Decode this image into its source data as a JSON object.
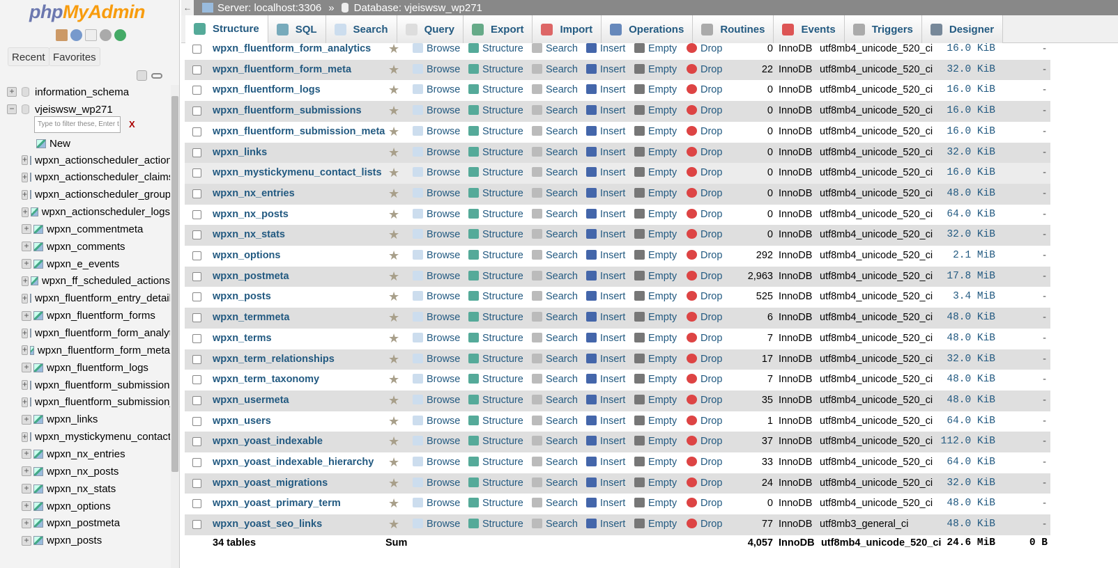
{
  "sidebar": {
    "logo_php": "php",
    "logo_myadmin": "MyAdmin",
    "recent": "Recent",
    "favorites": "Favorites",
    "filter_placeholder": "Type to filter these, Enter t",
    "filter_clear": "X",
    "databases": [
      "information_schema",
      "vjeiswsw_wp271"
    ],
    "new_label": "New",
    "tables": [
      "wpxn_actionscheduler_actions",
      "wpxn_actionscheduler_claims",
      "wpxn_actionscheduler_groups",
      "wpxn_actionscheduler_logs",
      "wpxn_commentmeta",
      "wpxn_comments",
      "wpxn_e_events",
      "wpxn_ff_scheduled_actions",
      "wpxn_fluentform_entry_details",
      "wpxn_fluentform_forms",
      "wpxn_fluentform_form_analytics",
      "wpxn_fluentform_form_meta",
      "wpxn_fluentform_logs",
      "wpxn_fluentform_submissions",
      "wpxn_fluentform_submission_meta",
      "wpxn_links",
      "wpxn_mystickymenu_contact_lists",
      "wpxn_nx_entries",
      "wpxn_nx_posts",
      "wpxn_nx_stats",
      "wpxn_options",
      "wpxn_postmeta",
      "wpxn_posts"
    ]
  },
  "breadcrumb": {
    "server": "Server: localhost:3306",
    "sep": "»",
    "database": "Database: vjeiswsw_wp271"
  },
  "tabs": [
    {
      "label": "Structure",
      "color": "#5a9"
    },
    {
      "label": "SQL",
      "color": "#7ab"
    },
    {
      "label": "Search",
      "color": "#cde"
    },
    {
      "label": "Query",
      "color": "#ddd"
    },
    {
      "label": "Export",
      "color": "#6a8"
    },
    {
      "label": "Import",
      "color": "#d66"
    },
    {
      "label": "Operations",
      "color": "#68b"
    },
    {
      "label": "Routines",
      "color": "#aaa"
    },
    {
      "label": "Events",
      "color": "#d55"
    },
    {
      "label": "Triggers",
      "color": "#aaa"
    },
    {
      "label": "Designer",
      "color": "#789"
    }
  ],
  "actions": {
    "browse": "Browse",
    "structure": "Structure",
    "search": "Search",
    "insert": "Insert",
    "empty": "Empty",
    "drop": "Drop"
  },
  "rows": [
    [
      "wpxn_fluentform_form_analytics",
      "0",
      "InnoDB",
      "utf8mb4_unicode_520_ci",
      "16.0 KiB",
      "-"
    ],
    [
      "wpxn_fluentform_form_meta",
      "22",
      "InnoDB",
      "utf8mb4_unicode_520_ci",
      "32.0 KiB",
      "-"
    ],
    [
      "wpxn_fluentform_logs",
      "0",
      "InnoDB",
      "utf8mb4_unicode_520_ci",
      "16.0 KiB",
      "-"
    ],
    [
      "wpxn_fluentform_submissions",
      "0",
      "InnoDB",
      "utf8mb4_unicode_520_ci",
      "16.0 KiB",
      "-"
    ],
    [
      "wpxn_fluentform_submission_meta",
      "0",
      "InnoDB",
      "utf8mb4_unicode_520_ci",
      "16.0 KiB",
      "-"
    ],
    [
      "wpxn_links",
      "0",
      "InnoDB",
      "utf8mb4_unicode_520_ci",
      "32.0 KiB",
      "-"
    ],
    [
      "wpxn_mystickymenu_contact_lists",
      "0",
      "InnoDB",
      "utf8mb4_unicode_520_ci",
      "16.0 KiB",
      "-"
    ],
    [
      "wpxn_nx_entries",
      "0",
      "InnoDB",
      "utf8mb4_unicode_520_ci",
      "48.0 KiB",
      "-"
    ],
    [
      "wpxn_nx_posts",
      "0",
      "InnoDB",
      "utf8mb4_unicode_520_ci",
      "64.0 KiB",
      "-"
    ],
    [
      "wpxn_nx_stats",
      "0",
      "InnoDB",
      "utf8mb4_unicode_520_ci",
      "32.0 KiB",
      "-"
    ],
    [
      "wpxn_options",
      "292",
      "InnoDB",
      "utf8mb4_unicode_520_ci",
      "2.1 MiB",
      "-"
    ],
    [
      "wpxn_postmeta",
      "2,963",
      "InnoDB",
      "utf8mb4_unicode_520_ci",
      "17.8 MiB",
      "-"
    ],
    [
      "wpxn_posts",
      "525",
      "InnoDB",
      "utf8mb4_unicode_520_ci",
      "3.4 MiB",
      "-"
    ],
    [
      "wpxn_termmeta",
      "6",
      "InnoDB",
      "utf8mb4_unicode_520_ci",
      "48.0 KiB",
      "-"
    ],
    [
      "wpxn_terms",
      "7",
      "InnoDB",
      "utf8mb4_unicode_520_ci",
      "48.0 KiB",
      "-"
    ],
    [
      "wpxn_term_relationships",
      "17",
      "InnoDB",
      "utf8mb4_unicode_520_ci",
      "32.0 KiB",
      "-"
    ],
    [
      "wpxn_term_taxonomy",
      "7",
      "InnoDB",
      "utf8mb4_unicode_520_ci",
      "48.0 KiB",
      "-"
    ],
    [
      "wpxn_usermeta",
      "35",
      "InnoDB",
      "utf8mb4_unicode_520_ci",
      "48.0 KiB",
      "-"
    ],
    [
      "wpxn_users",
      "1",
      "InnoDB",
      "utf8mb4_unicode_520_ci",
      "64.0 KiB",
      "-"
    ],
    [
      "wpxn_yoast_indexable",
      "37",
      "InnoDB",
      "utf8mb4_unicode_520_ci",
      "112.0 KiB",
      "-"
    ],
    [
      "wpxn_yoast_indexable_hierarchy",
      "33",
      "InnoDB",
      "utf8mb4_unicode_520_ci",
      "64.0 KiB",
      "-"
    ],
    [
      "wpxn_yoast_migrations",
      "24",
      "InnoDB",
      "utf8mb4_unicode_520_ci",
      "32.0 KiB",
      "-"
    ],
    [
      "wpxn_yoast_primary_term",
      "0",
      "InnoDB",
      "utf8mb4_unicode_520_ci",
      "48.0 KiB",
      "-"
    ],
    [
      "wpxn_yoast_seo_links",
      "77",
      "InnoDB",
      "utf8mb3_general_ci",
      "48.0 KiB",
      "-"
    ]
  ],
  "footer": {
    "tables": "34 tables",
    "sum": "Sum",
    "rows": "4,057",
    "engine": "InnoDB",
    "collation": "utf8mb4_unicode_520_ci",
    "size": "24.6 MiB",
    "overhead": "0 B"
  }
}
